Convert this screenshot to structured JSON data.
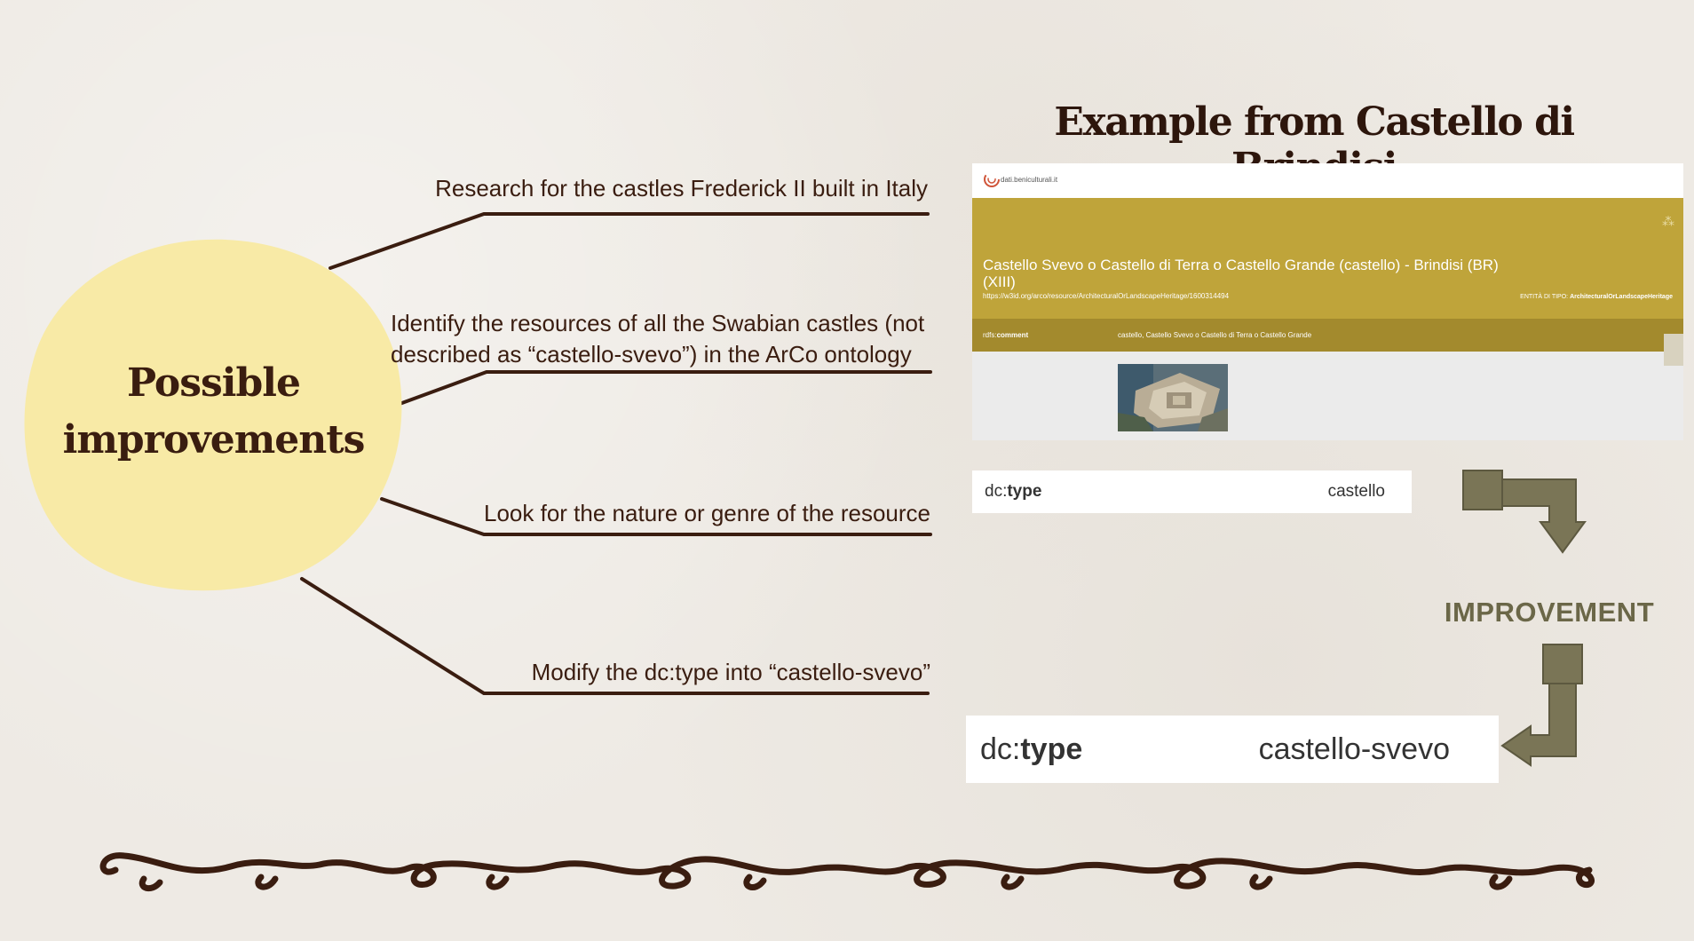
{
  "slide": {
    "center_node": {
      "line1": "Possible",
      "line2": "improvements"
    },
    "branches": [
      {
        "text": "Research for the castles Frederick II built in Italy"
      },
      {
        "line1": "Identify the resources of all the Swabian castles (not",
        "line2": "described as “castello-svevo”) in the ArCo ontology"
      },
      {
        "text": "Look for the nature or genre of the resource"
      },
      {
        "text": "Modify the dc:type into “castello-svevo”"
      }
    ],
    "example_title": "Example from Castello di Brindisi",
    "screenshot": {
      "logo_text": "dati.beniculturali.it",
      "heading": "Castello Svevo o Castello di Terra o Castello Grande (castello) - Brindisi (BR) (XIII)",
      "url": "https://w3id.org/arco/resource/ArchitecturalOrLandscapeHeritage/1600314494",
      "entity_label": "ENTITÀ DI TIPO:",
      "entity_value": "ArchitecturalOrLandscapeHeritage",
      "row_label_prefix": "rdfs:",
      "row_label_bold": "comment",
      "row_value": "castello, Castello Svevo o Castello di Terra o Castello Grande"
    },
    "dc_type_current": {
      "prefix": "dc:",
      "key": "type",
      "value": "castello"
    },
    "improvement_label": "IMPROVEMENT",
    "dc_type_improved": {
      "prefix": "dc:",
      "key": "type",
      "value": "castello-svevo"
    },
    "colors": {
      "background": "#eeeae4",
      "blob": "#f8eaa6",
      "dark_brown": "#3a1d10",
      "banner_gold": "#bfa43a",
      "arrow_olive": "#7a7556"
    }
  }
}
